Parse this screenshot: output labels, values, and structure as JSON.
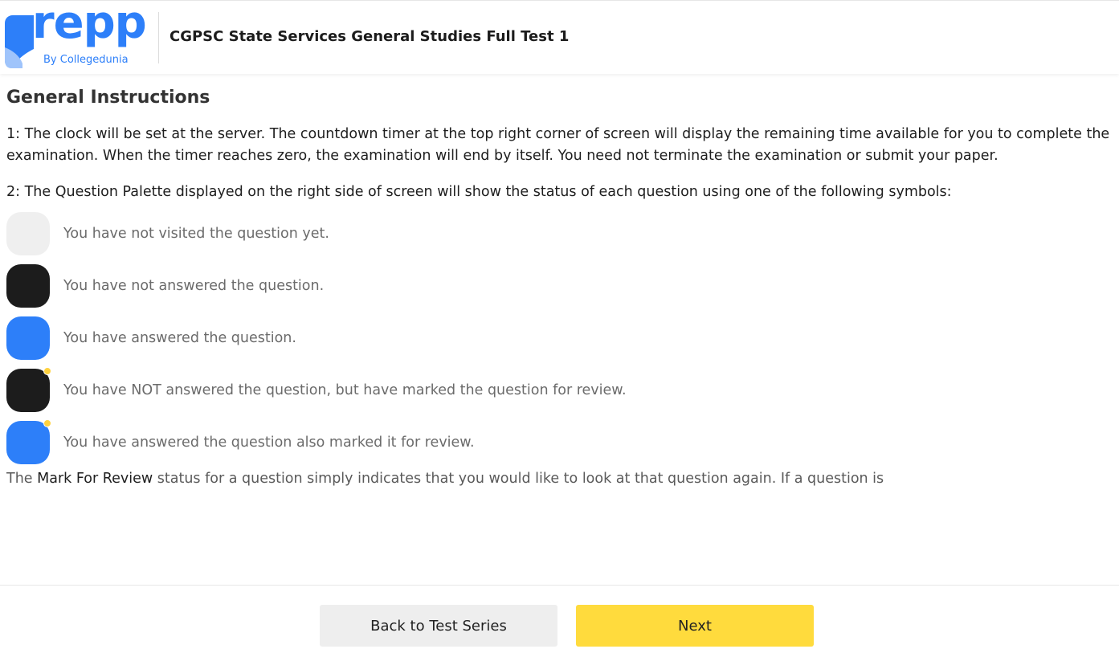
{
  "header": {
    "logo_text": "repp",
    "logo_sub": "By Collegedunia",
    "test_title": "CGPSC State Services General Studies Full Test 1"
  },
  "main": {
    "section_title": "General Instructions",
    "instruction_1": "1: The clock will be set at the server. The countdown timer at the top right corner of screen will display the remaining time available for you to complete the examination. When the timer reaches zero, the examination will end by itself. You need not terminate the examination or submit your paper.",
    "instruction_2": "2: The Question Palette displayed on the right side of screen will show the status of each question using one of the following symbols:",
    "legend": [
      {
        "icon": "not-visited-icon",
        "color": "#efefef",
        "marked": false,
        "text": "You have not visited the question yet."
      },
      {
        "icon": "not-answered-icon",
        "color": "#1c1c1c",
        "marked": false,
        "text": "You have not answered the question."
      },
      {
        "icon": "answered-icon",
        "color": "#2d7ff9",
        "marked": false,
        "text": "You have answered the question."
      },
      {
        "icon": "not-answered-marked-icon",
        "color": "#1c1c1c",
        "marked": true,
        "text": "You have NOT answered the question, but have marked the question for review."
      },
      {
        "icon": "answered-marked-icon",
        "color": "#2d7ff9",
        "marked": true,
        "text": "You have answered the question also marked it for review."
      }
    ],
    "note_prefix": "The ",
    "note_strong": "Mark For Review",
    "note_rest": " status for a question simply indicates that you would like to look at that question again. If a question is"
  },
  "footer": {
    "back_label": "Back to Test Series",
    "next_label": "Next"
  },
  "colors": {
    "brand_blue": "#2d7ff9",
    "next_yellow": "#ffdb3d",
    "review_dot": "#ffd23f"
  }
}
